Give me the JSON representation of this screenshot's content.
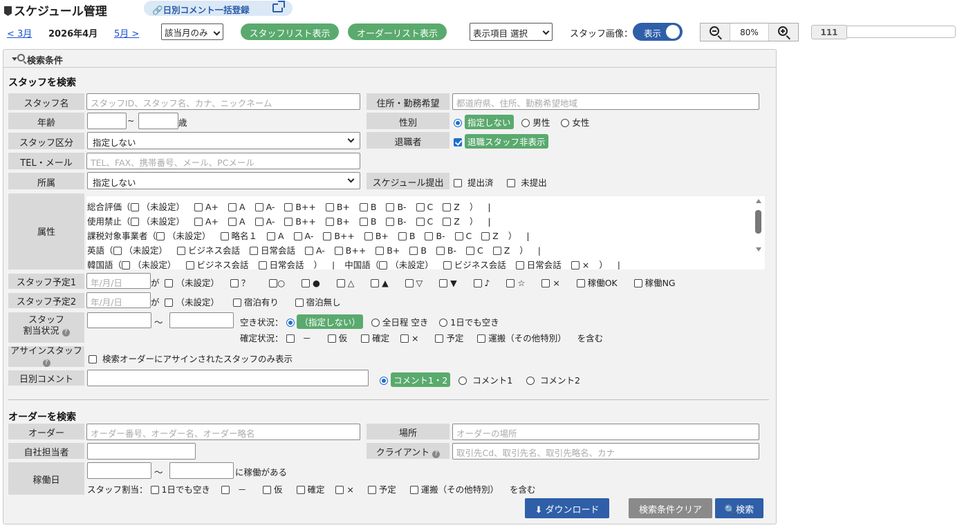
{
  "header": {
    "title": "スケジュール管理",
    "bulk_comment_link": "日別コメント一括登録",
    "prev_month": "< 3月",
    "current_month": "2026年4月",
    "next_month": "5月 >",
    "month_filter_value": "該当月のみ",
    "staff_list_button": "スタッフリスト表示",
    "order_list_button": "オーダーリスト表示",
    "display_items_value": "表示項目 選択",
    "staff_image_label": "スタッフ画像：",
    "staff_image_toggle": "表示",
    "zoom_level": "80%",
    "counter": "111"
  },
  "search": {
    "panel_title": "検索条件",
    "staff_section_title": "スタッフを検索",
    "order_section_title": "オーダーを検索",
    "labels": {
      "staff_name": "スタッフ名",
      "address": "住所・勤務希望",
      "age": "年齢",
      "gender": "性別",
      "staff_type": "スタッフ区分",
      "retired": "退職者",
      "tel_mail": "TEL・メール",
      "affiliation": "所属",
      "schedule_submit": "スケジュール提出",
      "attribute": "属性",
      "plan1": "スタッフ予定1",
      "plan2": "スタッフ予定2",
      "assign_status_1": "スタッフ",
      "assign_status_2": "割当状況",
      "assign_staff": "アサインスタッフ",
      "daily_comment": "日別コメント",
      "order": "オーダー",
      "place": "場所",
      "person_in_charge": "自社担当者",
      "client": "クライアント",
      "work_day": "稼働日"
    },
    "placeholders": {
      "staff_name": "スタッフID、スタッフ名、カナ、ニックネーム",
      "address": "都道府県、住所、勤務希望地域",
      "tel_mail": "TEL、FAX、携帯番号、メール、PCメール",
      "date": "年/月/日",
      "order": "オーダー番号、オーダー名、オーダー略名",
      "place": "オーダーの場所",
      "client": "取引先Cd、取引先名、取引先略名、カナ"
    },
    "age_tilde": "~",
    "age_unit": "歳",
    "gender_options": [
      "指定しない",
      "男性",
      "女性"
    ],
    "staff_type_value": "指定しない",
    "retired_option": "退職スタッフ非表示",
    "affiliation_value": "指定しない",
    "schedule_submit_options": [
      "提出済",
      "未提出"
    ],
    "attributes": [
      [
        "総合評価（",
        "（未設定）",
        "A+",
        "A",
        "A-",
        "B++",
        "B+",
        "B",
        "B-",
        "C",
        "Z",
        "）",
        "|"
      ],
      [
        "使用禁止（",
        "（未設定）",
        "A+",
        "A",
        "A-",
        "B++",
        "B+",
        "B",
        "B-",
        "C",
        "Z",
        "）",
        "|"
      ],
      [
        "課税対象事業者（",
        "（未設定）",
        "略名１",
        "A",
        "A-",
        "B++",
        "B+",
        "B",
        "B-",
        "C",
        "Z",
        "）",
        "|"
      ],
      [
        "英語（",
        "（未設定）",
        "ビジネス会話",
        "日常会話",
        "A-",
        "B++",
        "B+",
        "B",
        "B-",
        "C",
        "Z",
        "）",
        "|"
      ],
      [
        "韓国語（",
        "（未設定）",
        "ビジネス会話",
        "日常会話",
        "）",
        "|",
        "中国語（",
        "（未設定）",
        "ビジネス会話",
        "日常会話",
        "×",
        "）",
        "|"
      ]
    ],
    "plan_connector": "が",
    "plan1_options": [
      "（未設定）",
      "？",
      "○",
      "●",
      "△",
      "▲",
      "▽",
      "▼",
      "♪",
      "☆",
      "×",
      "稼働OK",
      "稼働NG"
    ],
    "plan2_options": [
      "（未設定）",
      "宿泊有り",
      "宿泊無し"
    ],
    "range_tilde": "～",
    "vacancy_label": "空き状況：",
    "vacancy_options": [
      "（指定しない）",
      "全日程 空き",
      "1日でも空き"
    ],
    "confirm_label": "確定状況：",
    "confirm_options": [
      "－",
      "仮",
      "確定",
      "×",
      "予定",
      "運搬（その他特別）"
    ],
    "include_label": "を含む",
    "assign_only_label": "検索オーダーにアサインされたスタッフのみ表示",
    "comment_options": [
      "コメント1・2",
      "コメント1",
      "コメント2"
    ],
    "work_suffix": "に稼働がある",
    "staff_assign_label": "スタッフ割当：",
    "staff_assign_options": [
      "1日でも空き",
      "－",
      "仮",
      "確定",
      "×",
      "予定",
      "運搬（その他特別）"
    ],
    "download_button": "ダウンロード",
    "clear_button": "検索条件クリア",
    "search_button": "検索"
  },
  "colors": {
    "accent_green": "#5aaa6e",
    "accent_blue": "#2f5fa8",
    "button_gray": "#8a8a8a"
  }
}
